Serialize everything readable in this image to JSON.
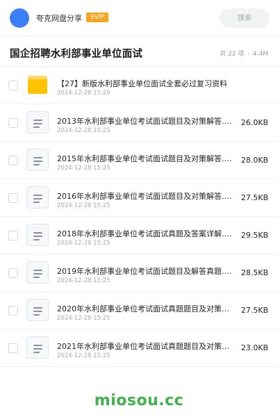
{
  "header": {
    "user_name": "夸克网盘分享",
    "badge": "SVIP",
    "search_placeholder": "搜索",
    "colors": {
      "avatar": "#3d7ef9",
      "badge": "#f5a623"
    }
  },
  "folder": {
    "title": "国企招聘水利部事业单位面试",
    "count": "共 22 项",
    "separator": "·",
    "size": "4.4M"
  },
  "items": [
    {
      "icon": "folder-icon",
      "name": "【27】新版水利部事业单位面试全套必过复习资料",
      "date": "2024-12-28 15:29",
      "size": ""
    },
    {
      "icon": "document-icon",
      "name": "2013年水利部事业单位考试面试题目及对策解答.d…",
      "date": "2024-12-28 15:25",
      "size": "26.0KB"
    },
    {
      "icon": "document-icon",
      "name": "2015年水利部事业单位考试面试题目及对策解答.d…",
      "date": "2024-12-28 15:25",
      "size": "28.0KB"
    },
    {
      "icon": "document-icon",
      "name": "2016年水利部事业单位考试面试题目及对策解答.d…",
      "date": "2024-12-28 15:25",
      "size": "27.5KB"
    },
    {
      "icon": "document-icon",
      "name": "2018年水利部事业单位考试面试真题及答案详解.d…",
      "date": "2024-12-28 15:25",
      "size": "29.5KB"
    },
    {
      "icon": "document-icon",
      "name": "2019年水利部事业单位考试面试题目及解答真题.d…",
      "date": "2024-12-28 15:25",
      "size": "28.5KB"
    },
    {
      "icon": "document-icon",
      "name": "2020年水利部事业单位考试面试真题题目及对策解答…",
      "date": "2024-12-28 15:25",
      "size": "27.5KB"
    },
    {
      "icon": "document-icon",
      "name": "2021年水利部事业单位考试面试真题题目及对策解答…",
      "date": "2024-12-28 15:25",
      "size": "23.0KB"
    }
  ],
  "watermark": "miosou.cc"
}
